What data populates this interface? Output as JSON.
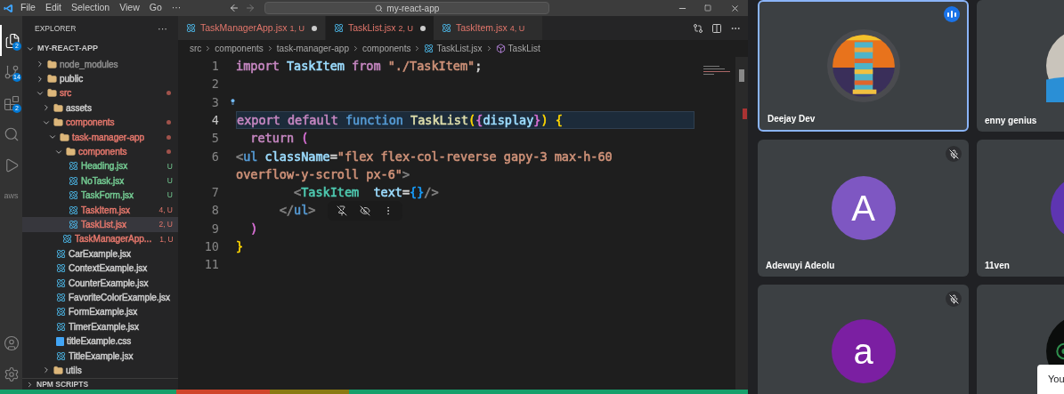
{
  "title_bar": {
    "menu": [
      "File",
      "Edit",
      "Selection",
      "View",
      "Go",
      "···"
    ],
    "search": {
      "value": "my-react-app"
    }
  },
  "activity_bar": {
    "items": [
      {
        "kind": "explorer",
        "badge": "2",
        "selected": true
      },
      {
        "kind": "source-control",
        "badge": "14",
        "selected": false
      },
      {
        "kind": "extensions",
        "badge": "2",
        "selected": false
      },
      {
        "kind": "search",
        "selected": false
      },
      {
        "kind": "run",
        "selected": false
      },
      {
        "kind": "aws",
        "label": "aws",
        "selected": false
      }
    ],
    "bottom": [
      {
        "kind": "account"
      },
      {
        "kind": "settings"
      }
    ]
  },
  "explorer": {
    "title": "EXPLORER",
    "more": "···",
    "root": {
      "label": "MY-REACT-APP",
      "expanded": true
    },
    "items": [
      {
        "label": "node_modules",
        "kind": "folder",
        "expanded": false,
        "dot": false,
        "selected": false,
        "color": "#8c8c8c"
      },
      {
        "label": "public",
        "kind": "folder",
        "expanded": false,
        "dot": false,
        "selected": false,
        "color": "#cccccc"
      },
      {
        "label": "src",
        "kind": "folder",
        "expanded": true,
        "dot": true,
        "selected": false,
        "color": "#e2766b",
        "children": [
          {
            "label": "assets",
            "kind": "folder",
            "expanded": false,
            "dot": false,
            "selected": false,
            "color": "#cccccc"
          },
          {
            "label": "components",
            "kind": "folder",
            "expanded": true,
            "dot": true,
            "selected": false,
            "color": "#e2766b",
            "children": [
              {
                "label": "task-manager-app",
                "kind": "folder",
                "expanded": true,
                "dot": true,
                "selected": false,
                "color": "#e2766b",
                "children": [
                  {
                    "label": "components",
                    "kind": "folder",
                    "expanded": true,
                    "dot": true,
                    "selected": false,
                    "color": "#e2766b",
                    "children": [
                      {
                        "label": "Heading.jsx",
                        "kind": "react",
                        "badge": "U",
                        "selected": false,
                        "color": "#73c991"
                      },
                      {
                        "label": "NoTask.jsx",
                        "kind": "react",
                        "badge": "U",
                        "selected": false,
                        "color": "#73c991"
                      },
                      {
                        "label": "TaskForm.jsx",
                        "kind": "react",
                        "badge": "U",
                        "selected": false,
                        "color": "#73c991"
                      },
                      {
                        "label": "TaskItem.jsx",
                        "kind": "react",
                        "badge": "4, U",
                        "selected": false,
                        "color": "#e2766b"
                      },
                      {
                        "label": "TaskList.jsx",
                        "kind": "react",
                        "badge": "2, U",
                        "selected": true,
                        "color": "#e2766b"
                      }
                    ]
                  },
                  {
                    "label": "TaskManagerApp...",
                    "kind": "react",
                    "badge": "1, U",
                    "selected": false,
                    "color": "#e2766b"
                  }
                ]
              },
              {
                "label": "CarExample.jsx",
                "kind": "react",
                "selected": false,
                "color": "#cccccc"
              },
              {
                "label": "ContextExample.jsx",
                "kind": "react",
                "selected": false,
                "color": "#cccccc"
              },
              {
                "label": "CounterExample.jsx",
                "kind": "react",
                "selected": false,
                "color": "#cccccc"
              },
              {
                "label": "FavoriteColorExample.jsx",
                "kind": "react",
                "selected": false,
                "color": "#cccccc"
              },
              {
                "label": "FormExample.jsx",
                "kind": "react",
                "selected": false,
                "color": "#cccccc"
              },
              {
                "label": "TimerExample.jsx",
                "kind": "react",
                "selected": false,
                "color": "#cccccc"
              },
              {
                "label": "titleExample.css",
                "kind": "css",
                "selected": false,
                "color": "#cccccc"
              },
              {
                "label": "TitleExample.jsx",
                "kind": "react",
                "selected": false,
                "color": "#cccccc"
              }
            ]
          },
          {
            "label": "utils",
            "kind": "folder",
            "expanded": false,
            "dot": false,
            "selected": false,
            "color": "#cccccc"
          }
        ]
      }
    ],
    "sections": [
      {
        "label": "NPM SCRIPTS",
        "expanded": false
      }
    ]
  },
  "tabs": [
    {
      "label": "TaskManagerApp.jsx",
      "badge": "1, U",
      "dirty": true,
      "selected": false
    },
    {
      "label": "TaskList.jsx",
      "badge": "2, U",
      "dirty": true,
      "selected": true
    },
    {
      "label": "TaskItem.jsx",
      "badge": "4, U",
      "dirty": false,
      "selected": false
    }
  ],
  "breadcrumbs": [
    {
      "label": "src",
      "kind": "text"
    },
    {
      "label": "components",
      "kind": "text"
    },
    {
      "label": "task-manager-app",
      "kind": "text"
    },
    {
      "label": "components",
      "kind": "text"
    },
    {
      "label": "TaskList.jsx",
      "kind": "react"
    },
    {
      "label": "TaskList",
      "kind": "symbol"
    }
  ],
  "code": [
    {
      "number": "1",
      "current": false,
      "lightbulb": false,
      "toolbar": false,
      "tokens": [
        {
          "text": "import ",
          "color": "#c586c0"
        },
        {
          "text": "TaskItem ",
          "color": "#9cdcfe"
        },
        {
          "text": "from ",
          "color": "#c586c0"
        },
        {
          "text": "\"./TaskItem\"",
          "color": "#ce9178"
        },
        {
          "text": ";",
          "color": "#d4d4d4"
        }
      ]
    },
    {
      "number": "2",
      "current": false,
      "lightbulb": false,
      "toolbar": false
    },
    {
      "number": "3",
      "current": false,
      "lightbulb": true,
      "toolbar": false
    },
    {
      "number": "4",
      "current": true,
      "lightbulb": false,
      "toolbar": false,
      "tokens": [
        {
          "text": "export default ",
          "color": "#c586c0"
        },
        {
          "text": "function ",
          "color": "#569cd6"
        },
        {
          "text": "TaskList",
          "color": "#dcdcaa"
        },
        {
          "text": "(",
          "color": "#ffd700"
        },
        {
          "text": "{",
          "color": "#da70d6"
        },
        {
          "text": "display",
          "color": "#9cdcfe"
        },
        {
          "text": "}",
          "color": "#da70d6"
        },
        {
          "text": ") ",
          "color": "#ffd700"
        },
        {
          "text": "{",
          "color": "#ffd700"
        }
      ]
    },
    {
      "number": "5",
      "current": false,
      "lightbulb": false,
      "toolbar": false,
      "tokens": [
        {
          "text": "  return ",
          "color": "#c586c0"
        },
        {
          "text": "(",
          "color": "#da70d6"
        }
      ]
    },
    {
      "number": "6",
      "current": false,
      "lightbulb": false,
      "toolbar": false,
      "tokens": [
        {
          "text": "<",
          "color": "#808080"
        },
        {
          "text": "ul ",
          "color": "#569cd6"
        },
        {
          "text": "className",
          "color": "#9cdcfe"
        },
        {
          "text": "=",
          "color": "#d4d4d4"
        },
        {
          "text": "\"flex flex-col-reverse gapy-3 max-h-60",
          "color": "#ce9178"
        }
      ]
    },
    {
      "current": false,
      "lightbulb": false,
      "toolbar": false,
      "tokens": [
        {
          "text": "overflow-y-scroll px-6\"",
          "color": "#ce9178"
        },
        {
          "text": ">",
          "color": "#808080"
        }
      ]
    },
    {
      "number": "7",
      "current": false,
      "lightbulb": false,
      "toolbar": false,
      "tokens": [
        {
          "text": "        <",
          "color": "#808080"
        },
        {
          "text": "TaskItem  ",
          "color": "#4ec9b0"
        },
        {
          "text": "text",
          "color": "#9cdcfe"
        },
        {
          "text": "=",
          "color": "#d4d4d4"
        },
        {
          "text": "{}",
          "color": "#179fff"
        },
        {
          "text": "/>",
          "color": "#808080"
        }
      ]
    },
    {
      "number": "8",
      "current": false,
      "lightbulb": false,
      "toolbar": true,
      "tokens": [
        {
          "text": "      </",
          "color": "#808080"
        },
        {
          "text": "ul",
          "color": "#569cd6"
        },
        {
          "text": ">",
          "color": "#808080"
        }
      ]
    },
    {
      "number": "9",
      "current": false,
      "lightbulb": false,
      "toolbar": false,
      "tokens": [
        {
          "text": "  )",
          "color": "#da70d6"
        }
      ]
    },
    {
      "number": "10",
      "current": false,
      "lightbulb": false,
      "toolbar": false,
      "tokens": [
        {
          "text": "}",
          "color": "#ffd700"
        }
      ]
    },
    {
      "number": "11",
      "current": false,
      "lightbulb": false,
      "toolbar": false
    }
  ],
  "status_bar": {
    "segments": [
      {
        "color": "#16a06b"
      },
      {
        "color": "#d0452b"
      },
      {
        "color": "#8a7a12"
      },
      {
        "color": "#16a06b"
      }
    ]
  },
  "meeting": {
    "tiles": [
      {
        "name": "Deejay Dev",
        "speaking": true,
        "muted": false,
        "selected": true
      },
      {
        "name": "enny genius",
        "selected": false
      },
      {
        "name": "Adewuyi Adeolu",
        "avatar": {
          "kind": "letter",
          "letter": "A",
          "color": "#7e57c2"
        },
        "speaking": false,
        "muted": true,
        "selected": false
      },
      {
        "name": "11ven",
        "avatar": {
          "kind": "letter",
          "color": "#5e35b1"
        },
        "selected": false
      },
      {
        "avatar": {
          "kind": "letter",
          "letter": "a",
          "color": "#7b1fa2"
        },
        "speaking": false,
        "muted": true,
        "selected": false
      },
      {
        "selected": false
      }
    ],
    "toast": {
      "text": "You"
    }
  }
}
